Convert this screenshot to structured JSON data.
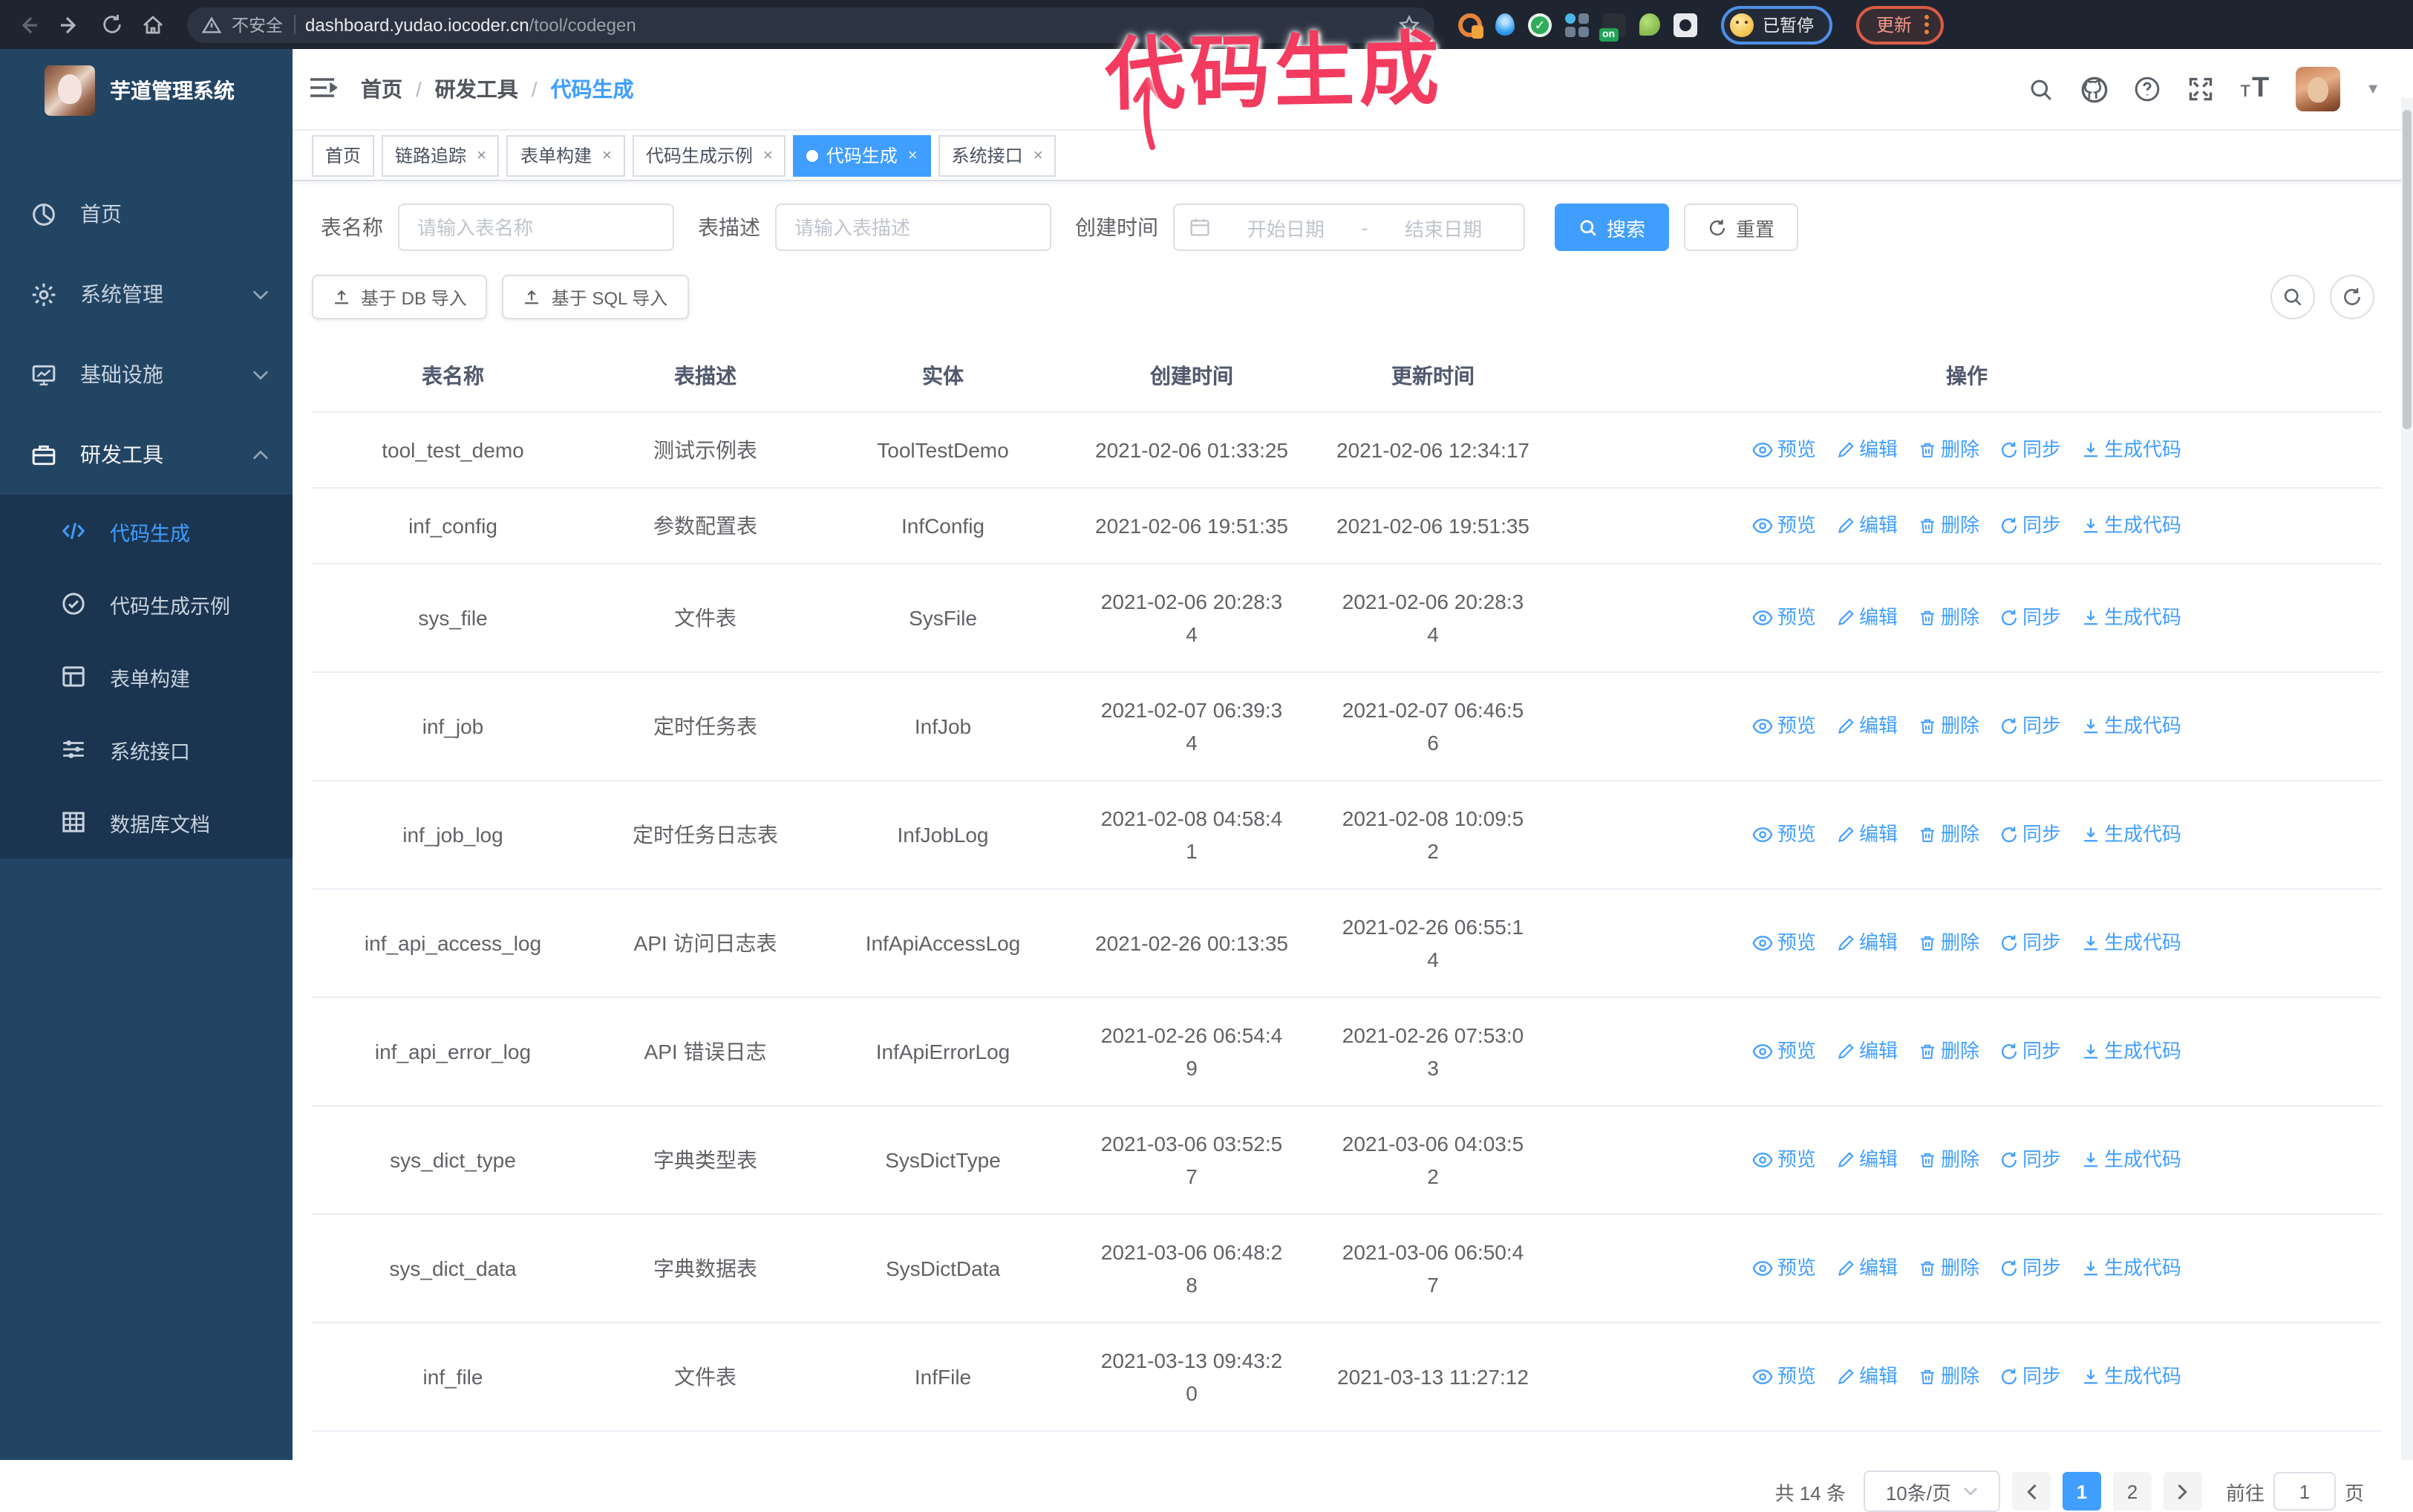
{
  "annotation": {
    "title": "代码生成"
  },
  "browser": {
    "security_label": "不安全",
    "url_domain": "dashboard.yudao.iocoder.cn",
    "url_path": "/tool/codegen",
    "extension_on_label": "on",
    "profile_badge": "已暂停",
    "update_label": "更新"
  },
  "sidebar": {
    "app_title": "芋道管理系统",
    "items": [
      {
        "label": "首页",
        "icon": "dashboard",
        "expand": null,
        "active": false
      },
      {
        "label": "系统管理",
        "icon": "gear",
        "expand": "down",
        "active": false
      },
      {
        "label": "基础设施",
        "icon": "infra",
        "expand": "down",
        "active": false
      },
      {
        "label": "研发工具",
        "icon": "tools",
        "expand": "up",
        "active": true
      }
    ],
    "subitems": [
      {
        "label": "代码生成",
        "icon": "code",
        "active": true
      },
      {
        "label": "代码生成示例",
        "icon": "sample",
        "active": false
      },
      {
        "label": "表单构建",
        "icon": "form",
        "active": false
      },
      {
        "label": "系统接口",
        "icon": "api",
        "active": false
      },
      {
        "label": "数据库文档",
        "icon": "db",
        "active": false
      }
    ]
  },
  "breadcrumb": {
    "items": [
      "首页",
      "研发工具"
    ],
    "current": "代码生成",
    "separator": "/"
  },
  "tabs": [
    {
      "label": "首页",
      "closable": false,
      "active": false
    },
    {
      "label": "链路追踪",
      "closable": true,
      "active": false
    },
    {
      "label": "表单构建",
      "closable": true,
      "active": false
    },
    {
      "label": "代码生成示例",
      "closable": true,
      "active": false
    },
    {
      "label": "代码生成",
      "closable": true,
      "active": true
    },
    {
      "label": "系统接口",
      "closable": true,
      "active": false
    }
  ],
  "filters": {
    "table_name_label": "表名称",
    "table_name_placeholder": "请输入表名称",
    "table_desc_label": "表描述",
    "table_desc_placeholder": "请输入表描述",
    "create_time_label": "创建时间",
    "start_placeholder": "开始日期",
    "range_separator": "-",
    "end_placeholder": "结束日期",
    "search_label": "搜索",
    "reset_label": "重置"
  },
  "toolbar": {
    "import_db_label": "基于 DB 导入",
    "import_sql_label": "基于 SQL 导入"
  },
  "table": {
    "columns": [
      "表名称",
      "表描述",
      "实体",
      "创建时间",
      "更新时间",
      "操作"
    ],
    "actions": [
      {
        "label": "预览",
        "icon": "eye"
      },
      {
        "label": "编辑",
        "icon": "edit"
      },
      {
        "label": "删除",
        "icon": "trash"
      },
      {
        "label": "同步",
        "icon": "sync"
      },
      {
        "label": "生成代码",
        "icon": "download"
      }
    ],
    "rows": [
      {
        "name": "tool_test_demo",
        "desc": "测试示例表",
        "entity": "ToolTestDemo",
        "created": "2021-02-06 01:33:25",
        "updated": "2021-02-06 12:34:17"
      },
      {
        "name": "inf_config",
        "desc": "参数配置表",
        "entity": "InfConfig",
        "created": "2021-02-06 19:51:35",
        "updated": "2021-02-06 19:51:35"
      },
      {
        "name": "sys_file",
        "desc": "文件表",
        "entity": "SysFile",
        "created": "2021-02-06 20:28:3\n4",
        "updated": "2021-02-06 20:28:3\n4"
      },
      {
        "name": "inf_job",
        "desc": "定时任务表",
        "entity": "InfJob",
        "created": "2021-02-07 06:39:3\n4",
        "updated": "2021-02-07 06:46:5\n6"
      },
      {
        "name": "inf_job_log",
        "desc": "定时任务日志表",
        "entity": "InfJobLog",
        "created": "2021-02-08 04:58:4\n1",
        "updated": "2021-02-08 10:09:5\n2"
      },
      {
        "name": "inf_api_access_log",
        "desc": "API 访问日志表",
        "entity": "InfApiAccessLog",
        "created": "2021-02-26 00:13:35",
        "updated": "2021-02-26 06:55:1\n4"
      },
      {
        "name": "inf_api_error_log",
        "desc": "API 错误日志",
        "entity": "InfApiErrorLog",
        "created": "2021-02-26 06:54:4\n9",
        "updated": "2021-02-26 07:53:0\n3"
      },
      {
        "name": "sys_dict_type",
        "desc": "字典类型表",
        "entity": "SysDictType",
        "created": "2021-03-06 03:52:5\n7",
        "updated": "2021-03-06 04:03:5\n2"
      },
      {
        "name": "sys_dict_data",
        "desc": "字典数据表",
        "entity": "SysDictData",
        "created": "2021-03-06 06:48:2\n8",
        "updated": "2021-03-06 06:50:4\n7"
      },
      {
        "name": "inf_file",
        "desc": "文件表",
        "entity": "InfFile",
        "created": "2021-03-13 09:43:2\n0",
        "updated": "2021-03-13 11:27:12"
      }
    ]
  },
  "pagination": {
    "total_label": "共 14 条",
    "page_size_label": "10条/页",
    "pages": [
      {
        "label": "1",
        "active": true
      },
      {
        "label": "2",
        "active": false
      }
    ],
    "goto_label": "前往",
    "goto_value": "1",
    "page_suffix": "页"
  },
  "colors": {
    "accent": "#409eff",
    "sidebar_bg": "#234564",
    "submenu_bg": "#1b3550",
    "chrome_bg": "#1e2530",
    "annotation": "#f23b5f",
    "update_badge": "#d95b45",
    "profile_badge_border": "#4e8fe8"
  }
}
